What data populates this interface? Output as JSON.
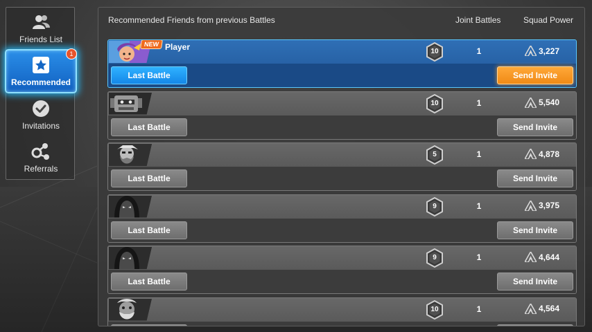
{
  "sidebar": {
    "items": [
      {
        "label": "Friends List",
        "icon": "friends-icon"
      },
      {
        "label": "Recommended",
        "icon": "star-icon",
        "badge": "1",
        "active": true
      },
      {
        "label": "Invitations",
        "icon": "checkmark-icon"
      },
      {
        "label": "Referrals",
        "icon": "referral-icon"
      }
    ]
  },
  "panel": {
    "title": "Recommended Friends from previous Battles",
    "col_joint": "Joint Battles",
    "col_power": "Squad Power"
  },
  "buttons": {
    "last_battle": "Last Battle",
    "send_invite": "Send Invite"
  },
  "rows": [
    {
      "name": "Player",
      "new_label": "NEW",
      "level": "10",
      "joint": "1",
      "power": "3,227",
      "selected": true,
      "avatar": "color-hero-portrait"
    },
    {
      "name": "",
      "level": "10",
      "joint": "1",
      "power": "5,540",
      "avatar": "robot-portrait"
    },
    {
      "name": "",
      "level": "5",
      "joint": "1",
      "power": "4,878",
      "avatar": "bearded-warrior-portrait"
    },
    {
      "name": "",
      "level": "9",
      "joint": "1",
      "power": "3,975",
      "avatar": "hooded-figure-portrait"
    },
    {
      "name": "",
      "level": "9",
      "joint": "1",
      "power": "4,644",
      "avatar": "hooded-figure-portrait"
    },
    {
      "name": "",
      "level": "10",
      "joint": "1",
      "power": "4,564",
      "avatar": "old-warrior-portrait"
    }
  ],
  "colors": {
    "accent_blue": "#1487e8",
    "accent_orange": "#f08a16",
    "selected_row": "#2762a6",
    "badge_red": "#e8542b"
  }
}
